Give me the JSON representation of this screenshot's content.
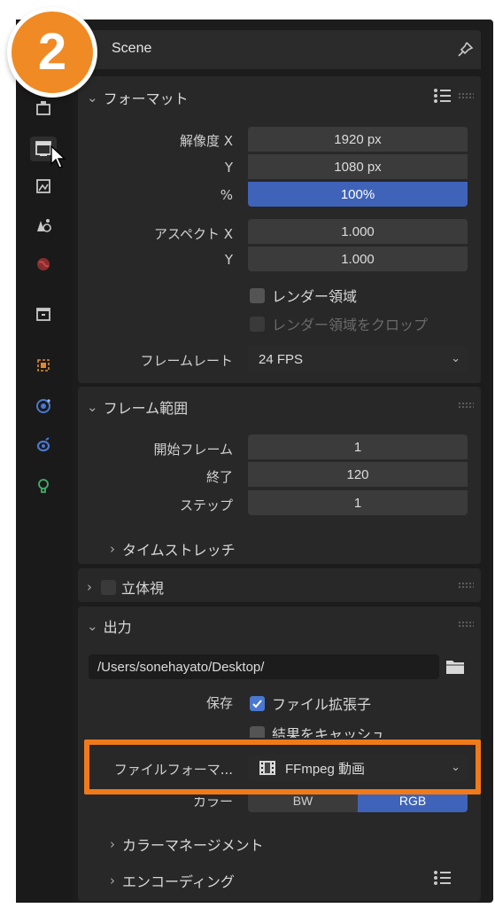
{
  "badge": {
    "number": "2"
  },
  "header": {
    "title": "Scene"
  },
  "format": {
    "title": "フォーマット",
    "res_x_label": "解像度 X",
    "res_x": "1920 px",
    "res_y_label": "Y",
    "res_y": "1080 px",
    "percent_label": "%",
    "percent": "100%",
    "aspect_x_label": "アスペクト X",
    "aspect_x": "1.000",
    "aspect_y_label": "Y",
    "aspect_y": "1.000",
    "render_region": "レンダー領域",
    "crop_region": "レンダー領域をクロップ",
    "framerate_label": "フレームレート",
    "framerate": "24 FPS"
  },
  "frame_range": {
    "title": "フレーム範囲",
    "start_label": "開始フレーム",
    "start": "1",
    "end_label": "終了",
    "end": "120",
    "step_label": "ステップ",
    "step": "1",
    "time_stretch": "タイムストレッチ"
  },
  "stereoscopy": {
    "title": "立体視"
  },
  "output": {
    "title": "出力",
    "path": "/Users/sonehayato/Desktop/",
    "save_label": "保存",
    "file_extensions": "ファイル拡張子",
    "cache_result": "結果をキャッシュ",
    "file_format_label": "ファイルフォーマ...",
    "file_format": "FFmpeg 動画",
    "color_label": "カラー",
    "color_bw": "BW",
    "color_rgb": "RGB",
    "color_management": "カラーマネージメント",
    "encoding": "エンコーディング"
  },
  "colors": {
    "accent": "#3f63b8",
    "highlight": "#f07a1a",
    "badge": "#f08a24"
  }
}
